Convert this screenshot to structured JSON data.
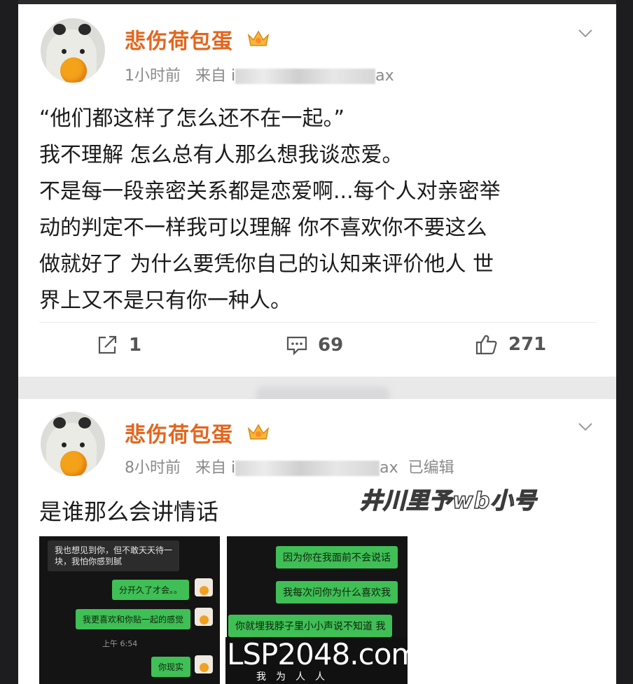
{
  "post1": {
    "username": "悲伤荷包蛋",
    "meta": {
      "time": "1小时前",
      "source_prefix": "来自 i",
      "source_suffix": "ax"
    },
    "lines": [
      "“他们都这样了怎么还不在一起。”",
      "我不理解 怎么总有人那么想我谈恋爱。",
      "不是每一段亲密关系都是恋爱啊...每个人对亲密举",
      "动的判定不一样我可以理解 你不喜欢你不要这么",
      "做就好了 为什么要凭你自己的认知来评价他人 世",
      "界上又不是只有你一种人。"
    ],
    "actions": {
      "repost": "1",
      "comment": "69",
      "like": "271"
    }
  },
  "post2": {
    "username": "悲伤荷包蛋",
    "meta": {
      "time": "8小时前",
      "source_prefix": "来自 i",
      "source_suffix": "ax",
      "edited": "已编辑"
    },
    "text": "是谁那么会讲情话",
    "overlay_tag": "井川里予wb小号",
    "screenshot_left": {
      "messages": [
        {
          "from": "other",
          "text_line1": "我也想见到你，但不敢天天待一",
          "text_line2": "块，我怕你感到腻"
        },
        {
          "from": "me",
          "text": "分开久了才会。。"
        },
        {
          "from": "me",
          "text": "我更喜欢和你贴一起的感觉"
        },
        {
          "from": "me",
          "text": "你现实"
        }
      ],
      "timestamp": "上午 6:54"
    },
    "screenshot_right": {
      "messages": [
        {
          "from": "me",
          "text": "因为你在我面前不会说话"
        },
        {
          "from": "me",
          "text": "我每次问你为什么喜欢我"
        },
        {
          "from": "me",
          "text": "你就埋我脖子里小小声说不知道 我"
        }
      ]
    }
  },
  "site_watermark": {
    "main": "LSP2048.com",
    "sub": "我为人人"
  }
}
